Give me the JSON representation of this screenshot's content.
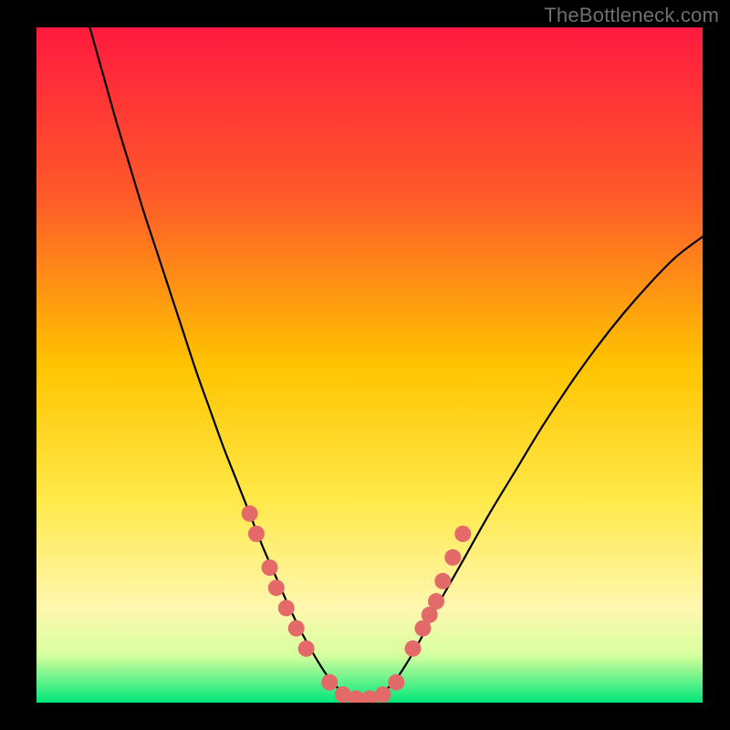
{
  "watermark": "TheBottleneck.com",
  "chart_data": {
    "type": "line",
    "title": "",
    "xlabel": "",
    "ylabel": "",
    "xlim": [
      0,
      100
    ],
    "ylim": [
      0,
      100
    ],
    "grid": false,
    "background_gradient": {
      "stops": [
        {
          "offset": 0,
          "color": "#ff1a3f"
        },
        {
          "offset": 25,
          "color": "#ff5a2a"
        },
        {
          "offset": 50,
          "color": "#ffc400"
        },
        {
          "offset": 70,
          "color": "#ffe94a"
        },
        {
          "offset": 86,
          "color": "#fff7b0"
        },
        {
          "offset": 93,
          "color": "#d6ff9e"
        },
        {
          "offset": 100,
          "color": "#00e77a"
        }
      ]
    },
    "series": [
      {
        "name": "curve",
        "color": "#000000",
        "x": [
          8,
          10,
          12,
          14,
          16,
          18,
          20,
          22,
          24,
          26,
          28,
          30,
          32,
          34,
          36,
          38,
          40,
          42,
          44,
          46,
          48,
          50,
          52,
          54,
          56,
          58,
          60,
          64,
          68,
          72,
          76,
          80,
          84,
          88,
          92,
          96,
          100
        ],
        "y": [
          100,
          93,
          86,
          79.5,
          73,
          67,
          61,
          55,
          49,
          43.5,
          38,
          33,
          28,
          23,
          18.5,
          14,
          10,
          6.5,
          3.5,
          1.5,
          0.5,
          0.5,
          1.5,
          3.5,
          6.5,
          10,
          14,
          21,
          28,
          34.5,
          41,
          47,
          52.5,
          57.5,
          62,
          66,
          69
        ]
      }
    ],
    "markers": {
      "name": "dots",
      "color": "#e46a6a",
      "radius_px": 9,
      "points": [
        [
          32,
          28
        ],
        [
          33,
          25
        ],
        [
          35,
          20
        ],
        [
          36,
          17
        ],
        [
          37.5,
          14
        ],
        [
          39,
          11
        ],
        [
          40.5,
          8
        ],
        [
          44,
          3
        ],
        [
          46,
          1.2
        ],
        [
          48,
          0.6
        ],
        [
          50,
          0.6
        ],
        [
          52,
          1.2
        ],
        [
          54,
          3
        ],
        [
          56.5,
          8
        ],
        [
          58,
          11
        ],
        [
          59,
          13
        ],
        [
          60,
          15
        ],
        [
          61,
          18
        ],
        [
          62.5,
          21.5
        ],
        [
          64,
          25
        ]
      ]
    }
  }
}
